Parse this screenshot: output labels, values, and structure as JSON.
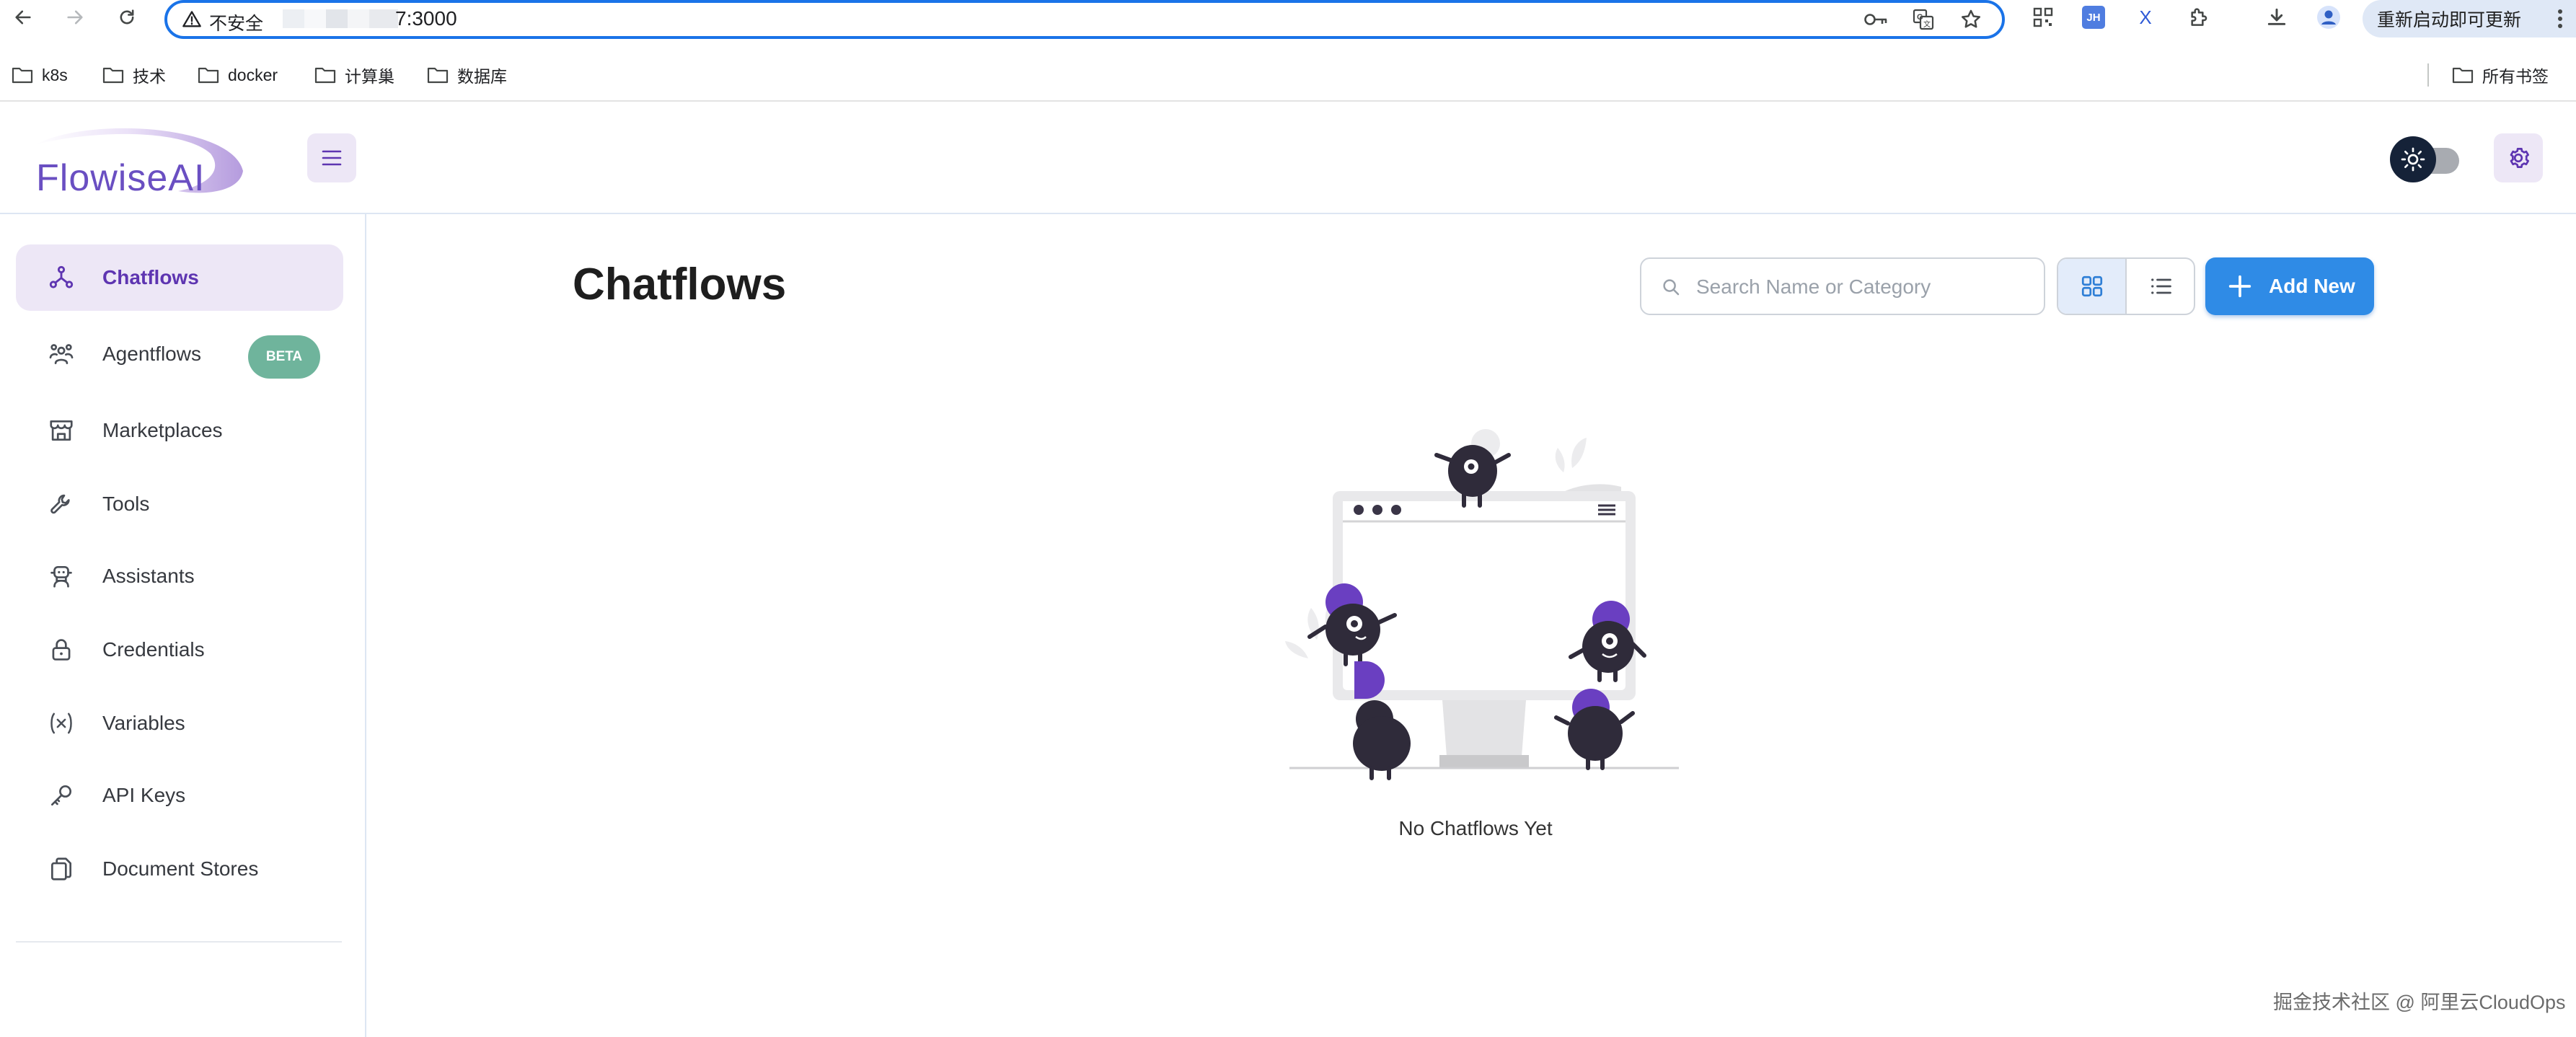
{
  "browser": {
    "security_label": "不安全",
    "url_visible": "7:3000",
    "update_button_label": "重新启动即可更新",
    "icons": [
      "back-icon",
      "forward-icon",
      "reload-icon",
      "warning-icon",
      "key-icon",
      "translate-icon",
      "star-icon",
      "qr-icon",
      "jh-extension-icon",
      "x-extension-icon",
      "puzzle-icon",
      "download-icon",
      "profile-icon",
      "menu-dots-icon"
    ],
    "extension_jh_label": "JH",
    "extension_x_label": "X"
  },
  "bookmarks": {
    "items": [
      "k8s",
      "技术",
      "docker",
      "计算巢",
      "数据库"
    ],
    "all_bookmarks_label": "所有书签"
  },
  "app": {
    "logo_text": "FlowiseAI",
    "colors": {
      "accent": "#5e35b1",
      "primary_button": "#2f8be6",
      "beta_badge": "#6fb49c"
    }
  },
  "sidebar": {
    "items": [
      {
        "label": "Chatflows",
        "icon": "chatflows-icon",
        "active": true
      },
      {
        "label": "Agentflows",
        "icon": "agentflows-icon",
        "badge": "BETA"
      },
      {
        "label": "Marketplaces",
        "icon": "marketplace-icon"
      },
      {
        "label": "Tools",
        "icon": "tools-icon"
      },
      {
        "label": "Assistants",
        "icon": "assistant-icon"
      },
      {
        "label": "Credentials",
        "icon": "lock-icon"
      },
      {
        "label": "Variables",
        "icon": "variable-icon"
      },
      {
        "label": "API Keys",
        "icon": "key-icon"
      },
      {
        "label": "Document Stores",
        "icon": "documents-icon"
      }
    ]
  },
  "main": {
    "title": "Chatflows",
    "search_placeholder": "Search Name or Category",
    "search_value": "",
    "view_mode": "card",
    "add_button_label": "Add New",
    "empty_message": "No Chatflows Yet"
  },
  "watermark": "掘金技术社区 @ 阿里云CloudOps"
}
